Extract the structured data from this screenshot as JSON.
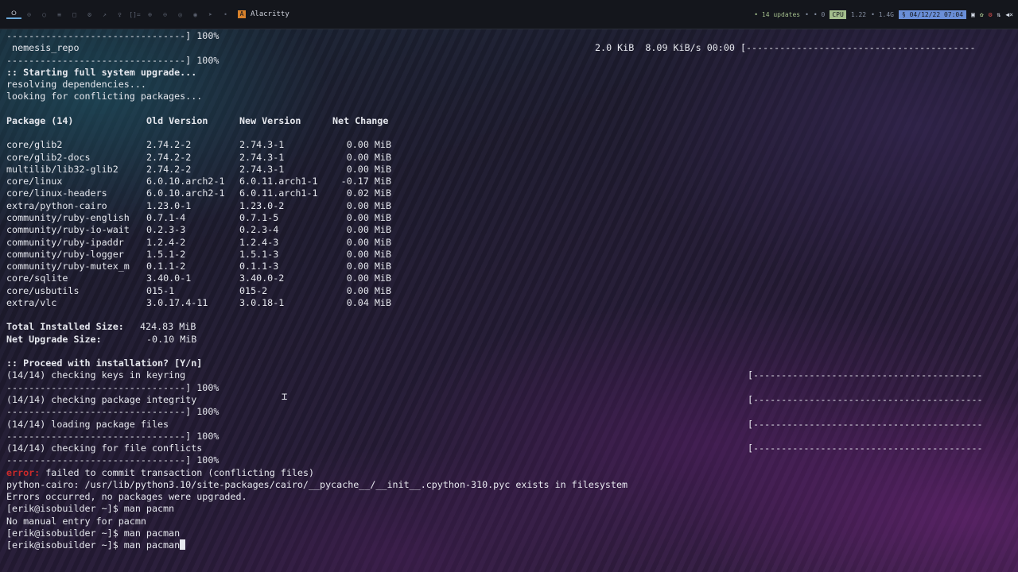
{
  "topbar": {
    "workspaces": [
      "⭘",
      "⊙",
      "○",
      "≡",
      "□",
      "⚙",
      "↗",
      "♀",
      "[]=",
      "⊕",
      "⊖",
      "◎",
      "◉",
      "➤",
      "•",
      "•"
    ],
    "window_title": "Alacritty",
    "updates": "• 14 updates",
    "bell": "•",
    "notif": "• 0",
    "cpu_label": "CPU",
    "cpu_value": "1.22",
    "mem": "• 1.4G",
    "datetime": "§ 04/12/22 07:04"
  },
  "terminal": {
    "line_01": "--------------------------------] 100%",
    "line_02": " nemesis_repo",
    "line_02_stats": "2.0 KiB  8.09 KiB/s 00:00 [-----------------------------------------",
    "line_03": "--------------------------------] 100%",
    "line_04": ":: Starting full system upgrade...",
    "line_05": "resolving dependencies...",
    "line_06": "looking for conflicting packages...",
    "table_headers": [
      "Package (14)",
      "Old Version",
      "New Version",
      "Net Change"
    ],
    "packages": [
      {
        "name": "core/glib2",
        "old": "2.74.2-2",
        "new": "2.74.3-1",
        "change": "0.00 MiB"
      },
      {
        "name": "core/glib2-docs",
        "old": "2.74.2-2",
        "new": "2.74.3-1",
        "change": "0.00 MiB"
      },
      {
        "name": "multilib/lib32-glib2",
        "old": "2.74.2-2",
        "new": "2.74.3-1",
        "change": "0.00 MiB"
      },
      {
        "name": "core/linux",
        "old": "6.0.10.arch2-1",
        "new": "6.0.11.arch1-1",
        "change": "-0.17 MiB"
      },
      {
        "name": "core/linux-headers",
        "old": "6.0.10.arch2-1",
        "new": "6.0.11.arch1-1",
        "change": "0.02 MiB"
      },
      {
        "name": "extra/python-cairo",
        "old": "1.23.0-1",
        "new": "1.23.0-2",
        "change": "0.00 MiB"
      },
      {
        "name": "community/ruby-english",
        "old": "0.7.1-4",
        "new": "0.7.1-5",
        "change": "0.00 MiB"
      },
      {
        "name": "community/ruby-io-wait",
        "old": "0.2.3-3",
        "new": "0.2.3-4",
        "change": "0.00 MiB"
      },
      {
        "name": "community/ruby-ipaddr",
        "old": "1.2.4-2",
        "new": "1.2.4-3",
        "change": "0.00 MiB"
      },
      {
        "name": "community/ruby-logger",
        "old": "1.5.1-2",
        "new": "1.5.1-3",
        "change": "0.00 MiB"
      },
      {
        "name": "community/ruby-mutex_m",
        "old": "0.1.1-2",
        "new": "0.1.1-3",
        "change": "0.00 MiB"
      },
      {
        "name": "core/sqlite",
        "old": "3.40.0-1",
        "new": "3.40.0-2",
        "change": "0.00 MiB"
      },
      {
        "name": "core/usbutils",
        "old": "015-1",
        "new": "015-2",
        "change": "0.00 MiB"
      },
      {
        "name": "extra/vlc",
        "old": "3.0.17.4-11",
        "new": "3.0.18-1",
        "change": "0.04 MiB"
      }
    ],
    "total_installed_label": "Total Installed Size:",
    "total_installed_value": "424.83 MiB",
    "net_upgrade_label": "Net Upgrade Size:",
    "net_upgrade_value": "-0.10 MiB",
    "proceed_prompt": ":: Proceed with installation? [Y/n]",
    "steps": [
      {
        "text": "(14/14) checking keys in keyring",
        "bar": "[-----------------------------------------",
        "done": "--------------------------------] 100%"
      },
      {
        "text": "(14/14) checking package integrity",
        "bar": "[-----------------------------------------",
        "done": "--------------------------------] 100%"
      },
      {
        "text": "(14/14) loading package files",
        "bar": "[-----------------------------------------",
        "done": "--------------------------------] 100%"
      },
      {
        "text": "(14/14) checking for file conflicts",
        "bar": "[-----------------------------------------",
        "done": "--------------------------------] 100%"
      }
    ],
    "error_prefix": "error:",
    "error_message": " failed to commit transaction (conflicting files)",
    "conflict_line": "python-cairo: /usr/lib/python3.10/site-packages/cairo/__pycache__/__init__.cpython-310.pyc exists in filesystem",
    "errors_line": "Errors occurred, no packages were upgraded.",
    "prompt_1": "[erik@isobuilder ~]$ man pacmn",
    "no_manual": "No manual entry for pacmn",
    "prompt_2": "[erik@isobuilder ~]$ man pacman",
    "prompt_3": "[erik@isobuilder ~]$ man pacman"
  },
  "colors": {
    "error_red": "#cc2a2a",
    "cpu_badge": "#a3be8c",
    "date_badge": "#6a8fd8"
  }
}
